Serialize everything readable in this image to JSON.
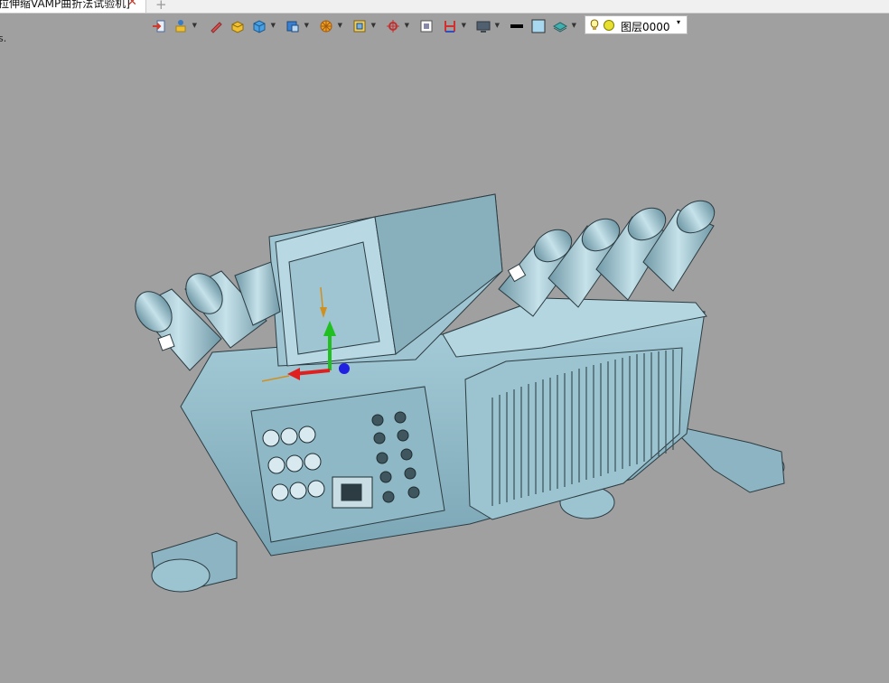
{
  "tab": {
    "title": "拉伸缩VAMP曲折法试验机]",
    "close": "✕",
    "add": "+"
  },
  "corner_text": "s.",
  "layer": {
    "name": "图层0000",
    "dropdown": "▾"
  },
  "colors": {
    "background": "#a0a0a0",
    "model": "#9cc3d0",
    "model_dark": "#6d93a0",
    "edge": "#2c3c42",
    "axis_x": "#e02020",
    "axis_y": "#20c020",
    "axis_z": "#2020e0"
  },
  "toolbar": {
    "buttons": [
      {
        "icon": "exit-icon",
        "caret": false
      },
      {
        "icon": "sketch-person-icon",
        "caret": true
      },
      {
        "icon": "pencil-icon",
        "caret": false
      },
      {
        "icon": "solid-box-icon",
        "caret": false
      },
      {
        "icon": "cube-icon",
        "caret": true
      },
      {
        "icon": "box-shaded-icon",
        "caret": true
      },
      {
        "icon": "render-wheel-icon",
        "caret": true
      },
      {
        "icon": "frame-icon",
        "caret": true
      },
      {
        "icon": "snap-icon",
        "caret": true
      },
      {
        "icon": "view-fit-icon",
        "caret": false
      },
      {
        "icon": "section-icon",
        "caret": true
      },
      {
        "icon": "display-icon",
        "caret": true
      },
      {
        "icon": "line-color-icon",
        "caret": false
      },
      {
        "icon": "fill-color-icon",
        "caret": false
      },
      {
        "icon": "layer-stack-icon",
        "caret": true
      }
    ]
  }
}
